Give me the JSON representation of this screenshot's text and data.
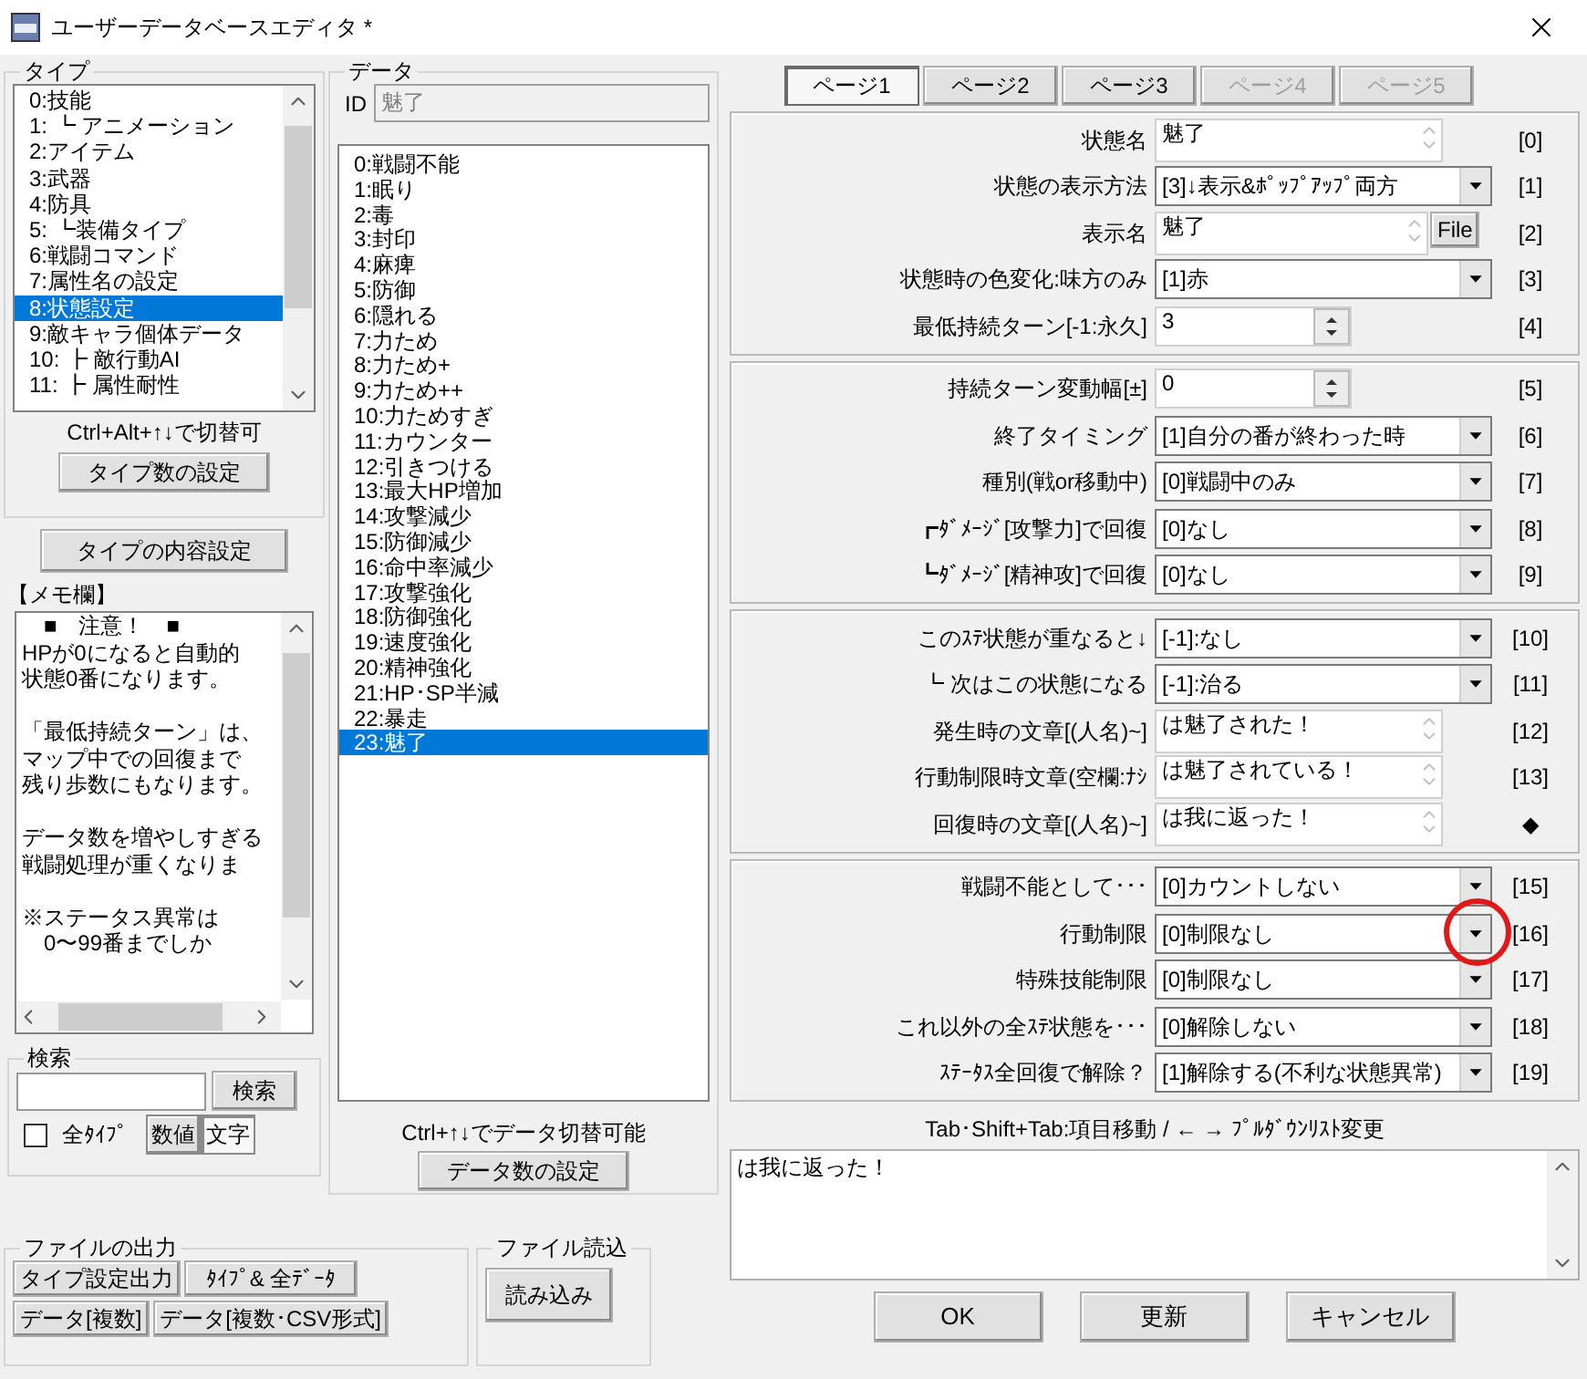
{
  "window": {
    "title": "ユーザーデータベースエディタ *"
  },
  "type_panel": {
    "title": "タイプ",
    "items": [
      {
        "label": "0:技能",
        "selected": false
      },
      {
        "label": "1: ┗ アニメーション",
        "selected": false
      },
      {
        "label": "2:アイテム",
        "selected": false
      },
      {
        "label": "3:武器",
        "selected": false
      },
      {
        "label": "4:防具",
        "selected": false
      },
      {
        "label": "5: ┗装備タイプ",
        "selected": false
      },
      {
        "label": "6:戦闘コマンド",
        "selected": false
      },
      {
        "label": "7:属性名の設定",
        "selected": false
      },
      {
        "label": "8:状態設定",
        "selected": true
      },
      {
        "label": "9:敵キャラ個体データ",
        "selected": false
      },
      {
        "label": "10: ┣ 敵行動AI",
        "selected": false
      },
      {
        "label": "11: ┣ 属性耐性",
        "selected": false
      }
    ],
    "hint": "Ctrl+Alt+↑↓で切替可",
    "button": "タイプ数の設定"
  },
  "type_content_button": "タイプの内容設定",
  "memo": {
    "title": "【メモ欄】",
    "paragraphs": [
      {
        "lines": [
          "　■　注意！　■",
          "HPが0になると自動的",
          "状態0番になります。"
        ]
      },
      {
        "lines": [
          "「最低持続ターン」は、",
          "マップ中での回復まで",
          "残り歩数にもなります。"
        ]
      },
      {
        "lines": [
          "データ数を増やしすぎる",
          "戦闘処理が重くなりま"
        ]
      },
      {
        "lines": [
          "※ステータス異常は",
          "　0〜99番までしか"
        ]
      }
    ]
  },
  "search": {
    "title": "検索",
    "button": "検索",
    "all_types": {
      "label": "全ﾀｲﾌﾟ",
      "checked": false
    },
    "modes": [
      {
        "label": "数値",
        "selected": false
      },
      {
        "label": "文字",
        "selected": true
      }
    ]
  },
  "data_panel": {
    "title": "データ",
    "id_label": "ID",
    "id_value": "魅了",
    "items": [
      {
        "label": "0:戦闘不能",
        "selected": false
      },
      {
        "label": "1:眠り",
        "selected": false
      },
      {
        "label": "2:毒",
        "selected": false
      },
      {
        "label": "3:封印",
        "selected": false
      },
      {
        "label": "4:麻痺",
        "selected": false
      },
      {
        "label": "5:防御",
        "selected": false
      },
      {
        "label": "6:隠れる",
        "selected": false
      },
      {
        "label": "7:力ため",
        "selected": false
      },
      {
        "label": "8:力ため+",
        "selected": false
      },
      {
        "label": "9:力ため++",
        "selected": false
      },
      {
        "label": "10:力ためすぎ",
        "selected": false
      },
      {
        "label": "11:カウンター",
        "selected": false
      },
      {
        "label": "12:引きつける",
        "selected": false
      },
      {
        "label": "13:最大HP増加",
        "selected": false
      },
      {
        "label": "14:攻撃減少",
        "selected": false
      },
      {
        "label": "15:防御減少",
        "selected": false
      },
      {
        "label": "16:命中率減少",
        "selected": false
      },
      {
        "label": "17:攻撃強化",
        "selected": false
      },
      {
        "label": "18:防御強化",
        "selected": false
      },
      {
        "label": "19:速度強化",
        "selected": false
      },
      {
        "label": "20:精神強化",
        "selected": false
      },
      {
        "label": "21:HP･SP半減",
        "selected": false
      },
      {
        "label": "22:暴走",
        "selected": false
      },
      {
        "label": "23:魅了",
        "selected": true
      }
    ],
    "hint": "Ctrl+↑↓でデータ切替可能",
    "button": "データ数の設定"
  },
  "file_output": {
    "title": "ファイルの出力",
    "buttons": [
      "タイプ設定出力",
      "ﾀｲﾌﾟ& 全ﾃﾞｰﾀ",
      "データ[複数]",
      "データ[複数･CSV形式]"
    ]
  },
  "file_input": {
    "title": "ファイル読込",
    "button": "読み込み"
  },
  "pages": [
    {
      "label": "ページ1",
      "selected": true,
      "disabled": false
    },
    {
      "label": "ページ2",
      "selected": false,
      "disabled": false
    },
    {
      "label": "ページ3",
      "selected": false,
      "disabled": false
    },
    {
      "label": "ページ4",
      "selected": false,
      "disabled": true
    },
    {
      "label": "ページ5",
      "selected": false,
      "disabled": true
    }
  ],
  "field_groups": [
    {
      "fields": [
        {
          "kind": "text",
          "label": "状態名",
          "value": "魅了",
          "index": "[0]"
        },
        {
          "kind": "select",
          "label": "状態の表示方法",
          "value": "[3]↓表示&ﾎﾟｯﾌﾟｱｯﾌﾟ両方",
          "index": "[1]"
        },
        {
          "kind": "file",
          "label": "表示名",
          "value": "魅了",
          "button": "File",
          "index": "[2]"
        },
        {
          "kind": "select",
          "label": "状態時の色変化:味方のみ",
          "value": "[1]赤",
          "index": "[3]"
        },
        {
          "kind": "spin",
          "label": "最低持続ターン[-1:永久]",
          "value": "3",
          "index": "[4]"
        }
      ]
    },
    {
      "fields": [
        {
          "kind": "spin",
          "label": "持続ターン変動幅[±]",
          "value": "0",
          "index": "[5]"
        },
        {
          "kind": "select",
          "label": "終了タイミング",
          "value": "[1]自分の番が終わった時",
          "index": "[6]"
        },
        {
          "kind": "select",
          "label": "種別(戦or移動中)",
          "value": "[0]戦闘中のみ",
          "index": "[7]"
        },
        {
          "kind": "select",
          "label": "┏ﾀﾞﾒｰｼﾞ[攻撃力]で回復",
          "value": "[0]なし",
          "index": "[8]"
        },
        {
          "kind": "select",
          "label": "┗ﾀﾞﾒｰｼﾞ[精神攻]で回復",
          "value": "[0]なし",
          "index": "[9]"
        }
      ]
    },
    {
      "fields": [
        {
          "kind": "select",
          "label": "このｽﾃ状態が重なると↓",
          "value": "[-1]:なし",
          "index": "[10]"
        },
        {
          "kind": "select",
          "label": "┗ 次はこの状態になる",
          "value": "[-1]:治る",
          "index": "[11]"
        },
        {
          "kind": "text",
          "label": "発生時の文章[(人名)~]",
          "value": "は魅了された！",
          "index": "[12]"
        },
        {
          "kind": "text",
          "label": "行動制限時文章(空欄:ﾅｼ",
          "value": "は魅了されている！",
          "index": "[13]"
        },
        {
          "kind": "text",
          "label": "回復時の文章[(人名)~]",
          "value": "は我に返った！",
          "index": "◆"
        }
      ]
    },
    {
      "fields": [
        {
          "kind": "select",
          "label": "戦闘不能として･･･",
          "value": "[0]カウントしない",
          "index": "[15]"
        },
        {
          "kind": "select",
          "label": "行動制限",
          "value": "[0]制限なし",
          "index": "[16]"
        },
        {
          "kind": "select",
          "label": "特殊技能制限",
          "value": "[0]制限なし",
          "index": "[17]"
        },
        {
          "kind": "select",
          "label": "これ以外の全ｽﾃ状態を･･･",
          "value": "[0]解除しない",
          "index": "[18]"
        },
        {
          "kind": "select",
          "label": "ｽﾃｰﾀｽ全回復で解除？",
          "value": "[1]解除する(不利な状態異常)",
          "index": "[19]"
        }
      ]
    }
  ],
  "hint": "Tab･Shift+Tab:項目移動 / ← → ﾌﾟﾙﾀﾞｳﾝﾘｽﾄ変更",
  "preview": "は我に返った！",
  "buttons": [
    "OK",
    "更新",
    "キャンセル"
  ]
}
